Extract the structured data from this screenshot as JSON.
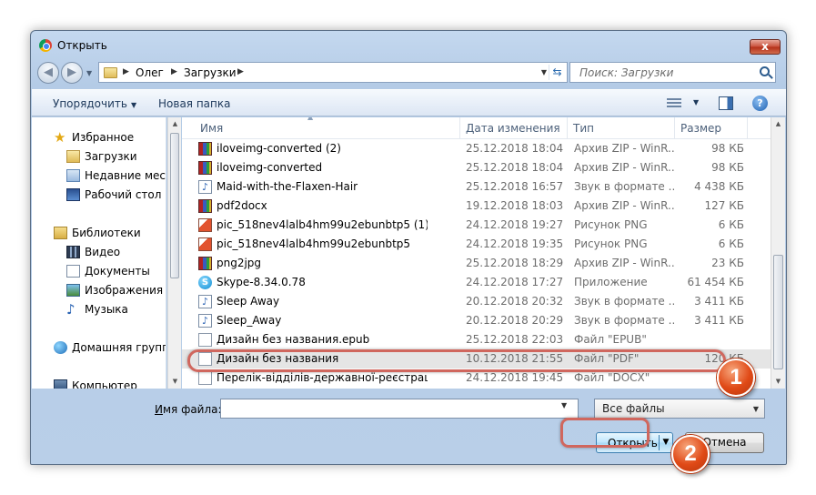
{
  "window": {
    "title": "Открыть",
    "close_label": "x"
  },
  "address": {
    "crumbs": [
      "Олег",
      "Загрузки"
    ],
    "search_placeholder": "Поиск: Загрузки"
  },
  "toolbar": {
    "organize_label": "Упорядочить",
    "new_folder_label": "Новая папка"
  },
  "sidebar": {
    "items": [
      {
        "label": "Избранное",
        "icon": "star-icon"
      },
      {
        "label": "Загрузки",
        "icon": "downloads-folder-icon"
      },
      {
        "label": "Недавние места",
        "icon": "recent-places-icon"
      },
      {
        "label": "Рабочий стол",
        "icon": "desktop-icon"
      },
      {
        "label": "Библиотеки",
        "icon": "libraries-icon"
      },
      {
        "label": "Видео",
        "icon": "video-icon"
      },
      {
        "label": "Документы",
        "icon": "documents-icon"
      },
      {
        "label": "Изображения",
        "icon": "images-icon"
      },
      {
        "label": "Музыка",
        "icon": "music-icon"
      },
      {
        "label": "Домашняя группа",
        "icon": "homegroup-icon"
      },
      {
        "label": "Компьютер",
        "icon": "computer-icon"
      }
    ]
  },
  "table": {
    "headers": [
      "Имя",
      "Дата изменения",
      "Тип",
      "Размер"
    ],
    "rows": [
      {
        "name": "iloveimg-converted (2)",
        "date": "25.12.2018 18:04",
        "type": "Архив ZIP - WinR...",
        "size": "98 КБ",
        "icon": "zip-icon"
      },
      {
        "name": "iloveimg-converted",
        "date": "25.12.2018 18:04",
        "type": "Архив ZIP - WinR...",
        "size": "98 КБ",
        "icon": "zip-icon"
      },
      {
        "name": "Maid-with-the-Flaxen-Hair",
        "date": "25.12.2018 16:57",
        "type": "Звук в формате ...",
        "size": "4 438 КБ",
        "icon": "audio-icon"
      },
      {
        "name": "pdf2docx",
        "date": "19.12.2018 18:03",
        "type": "Архив ZIP - WinR...",
        "size": "127 КБ",
        "icon": "zip-icon"
      },
      {
        "name": "pic_518nev4lalb4hm99u2ebunbtp5 (1)",
        "date": "24.12.2018 19:27",
        "type": "Рисунок PNG",
        "size": "6 КБ",
        "icon": "png-icon"
      },
      {
        "name": "pic_518nev4lalb4hm99u2ebunbtp5",
        "date": "24.12.2018 19:35",
        "type": "Рисунок PNG",
        "size": "6 КБ",
        "icon": "png-icon"
      },
      {
        "name": "png2jpg",
        "date": "25.12.2018 18:29",
        "type": "Архив ZIP - WinR...",
        "size": "23 КБ",
        "icon": "zip-icon"
      },
      {
        "name": "Skype-8.34.0.78",
        "date": "24.12.2018 17:27",
        "type": "Приложение",
        "size": "61 454 КБ",
        "icon": "skype-icon"
      },
      {
        "name": "Sleep Away",
        "date": "20.12.2018 20:32",
        "type": "Звук в формате ...",
        "size": "3 411 КБ",
        "icon": "audio-icon"
      },
      {
        "name": "Sleep_Away",
        "date": "20.12.2018 20:29",
        "type": "Звук в формате ...",
        "size": "3 411 КБ",
        "icon": "audio-icon"
      },
      {
        "name": "Дизайн без названия.epub",
        "date": "25.12.2018 22:03",
        "type": "Файл \"EPUB\"",
        "size": "",
        "icon": "file-icon"
      },
      {
        "name": "Дизайн без названия",
        "date": "10.12.2018 21:55",
        "type": "Файл \"PDF\"",
        "size": "120 КБ",
        "icon": "file-icon",
        "selected": true
      },
      {
        "name": "Перелік-відділів-державної-реєстрації-...",
        "date": "24.12.2018 19:45",
        "type": "Файл \"DOCX\"",
        "size": "",
        "icon": "file-icon"
      }
    ]
  },
  "bottom": {
    "filename_label_u": "И",
    "filename_label_rest": "мя файла:",
    "filename_value": "",
    "filter_value": "Все файлы",
    "open_label": "Открыть",
    "cancel_label": "Отмена"
  },
  "annotations": {
    "step1": "1",
    "step2": "2",
    "accent_color": "#d0675e",
    "badge_color": "#e04a17"
  }
}
